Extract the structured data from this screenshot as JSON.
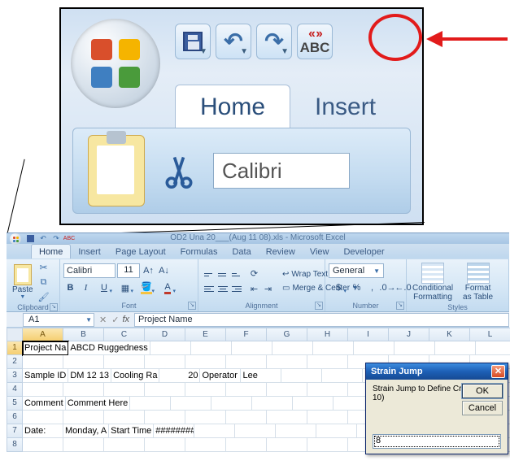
{
  "app_title": "OD2 Una 20___(Aug 11 08).xls - Microsoft Excel",
  "zoom": {
    "tabs": {
      "home": "Home",
      "insert": "Insert"
    },
    "abc_top": "‹‹ ››",
    "abc_text": "ABC",
    "font_name": "Calibri"
  },
  "qat": {
    "abc_text": "ABC"
  },
  "tabs": {
    "home": "Home",
    "insert": "Insert",
    "page_layout": "Page Layout",
    "formulas": "Formulas",
    "data": "Data",
    "review": "Review",
    "view": "View",
    "developer": "Developer"
  },
  "ribbon": {
    "paste": "Paste",
    "font_name": "Calibri",
    "font_size": "11",
    "wrap_text": "Wrap Text",
    "merge_center": "Merge & Center",
    "number_format": "General",
    "cond_fmt": "Conditional",
    "cond_fmt2": "Formatting",
    "fmt_table": "Format",
    "fmt_table2": "as Table",
    "group_clipboard": "Clipboard",
    "group_font": "Font",
    "group_alignment": "Alignment",
    "group_number": "Number",
    "group_styles": "Styles"
  },
  "name_box": "A1",
  "fx_label": "fx",
  "formula": "Project Name",
  "columns": [
    "A",
    "B",
    "C",
    "D",
    "E",
    "F",
    "G",
    "H",
    "I",
    "J",
    "K",
    "L"
  ],
  "rows": [
    "1",
    "2",
    "3",
    "4",
    "5",
    "6",
    "7",
    "8"
  ],
  "cells": {
    "r1": {
      "A": "Project Na",
      "B": "ABCD Ruggedness"
    },
    "r3": {
      "A": "Sample ID",
      "B": "DM 12 13",
      "C": "Cooling Ra",
      "D": "20",
      "E": "Operator",
      "F": "Lee"
    },
    "r5": {
      "A": "Comment",
      "B": "Comment Here"
    },
    "r7": {
      "A": "Date:",
      "B": "Monday, A",
      "C": "Start Time",
      "D": "########"
    }
  },
  "dialog": {
    "title": "Strain Jump",
    "message": "Strain Jump to Define Cracking (5-10)",
    "ok": "OK",
    "cancel": "Cancel",
    "input_value": "8"
  }
}
